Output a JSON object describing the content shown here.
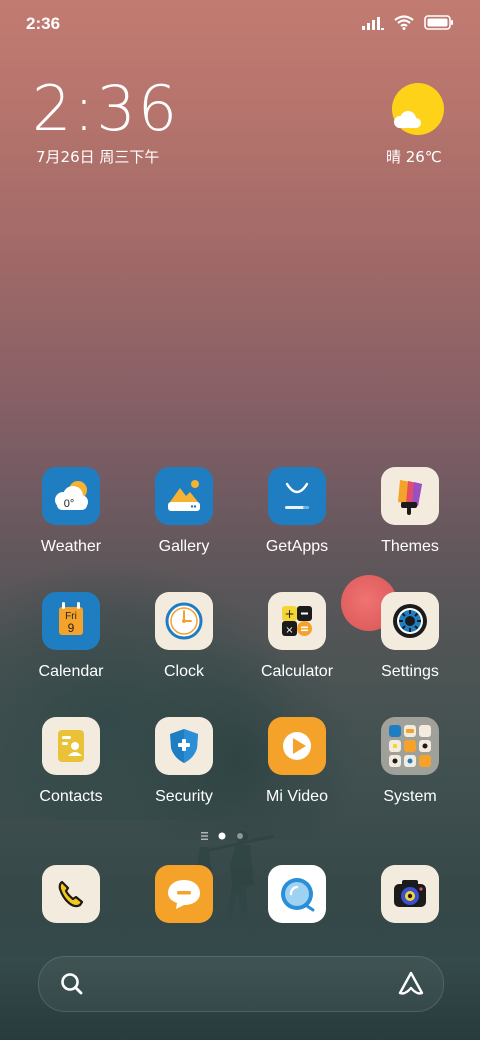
{
  "status_bar": {
    "time": "2:36",
    "icons": [
      "signal-icon",
      "wifi-icon",
      "battery-icon"
    ]
  },
  "clock_widget": {
    "time": "2:36",
    "date": "7月26日 周三下午"
  },
  "weather_widget": {
    "icon": "sun-cloud-icon",
    "text": "晴 26℃"
  },
  "apps": [
    {
      "label": "Weather",
      "icon": "weather-icon",
      "icon_text": "0°"
    },
    {
      "label": "Gallery",
      "icon": "gallery-icon"
    },
    {
      "label": "GetApps",
      "icon": "getapps-icon"
    },
    {
      "label": "Themes",
      "icon": "themes-icon"
    },
    {
      "label": "Calendar",
      "icon": "calendar-icon",
      "icon_day": "Fri",
      "icon_date": "9"
    },
    {
      "label": "Clock",
      "icon": "clock-icon"
    },
    {
      "label": "Calculator",
      "icon": "calculator-icon"
    },
    {
      "label": "Settings",
      "icon": "settings-icon"
    },
    {
      "label": "Contacts",
      "icon": "contacts-icon"
    },
    {
      "label": "Security",
      "icon": "security-icon"
    },
    {
      "label": "Mi Video",
      "icon": "mi-video-icon"
    },
    {
      "label": "System",
      "icon": "system-folder-icon"
    }
  ],
  "dock": [
    {
      "name": "phone",
      "icon": "phone-icon"
    },
    {
      "name": "messages",
      "icon": "messages-icon"
    },
    {
      "name": "browser",
      "icon": "browser-icon"
    },
    {
      "name": "camera",
      "icon": "camera-icon"
    }
  ],
  "page_indicator": {
    "pages": 2,
    "current": 1
  },
  "search": {
    "icon": "search-icon",
    "assistant_icon": "assistant-icon"
  },
  "colors": {
    "blue_icon": "#1f7ec1",
    "cream_icon": "#f4ebdf",
    "orange_icon": "#f5a22a",
    "accent_red": "#e0615f"
  }
}
